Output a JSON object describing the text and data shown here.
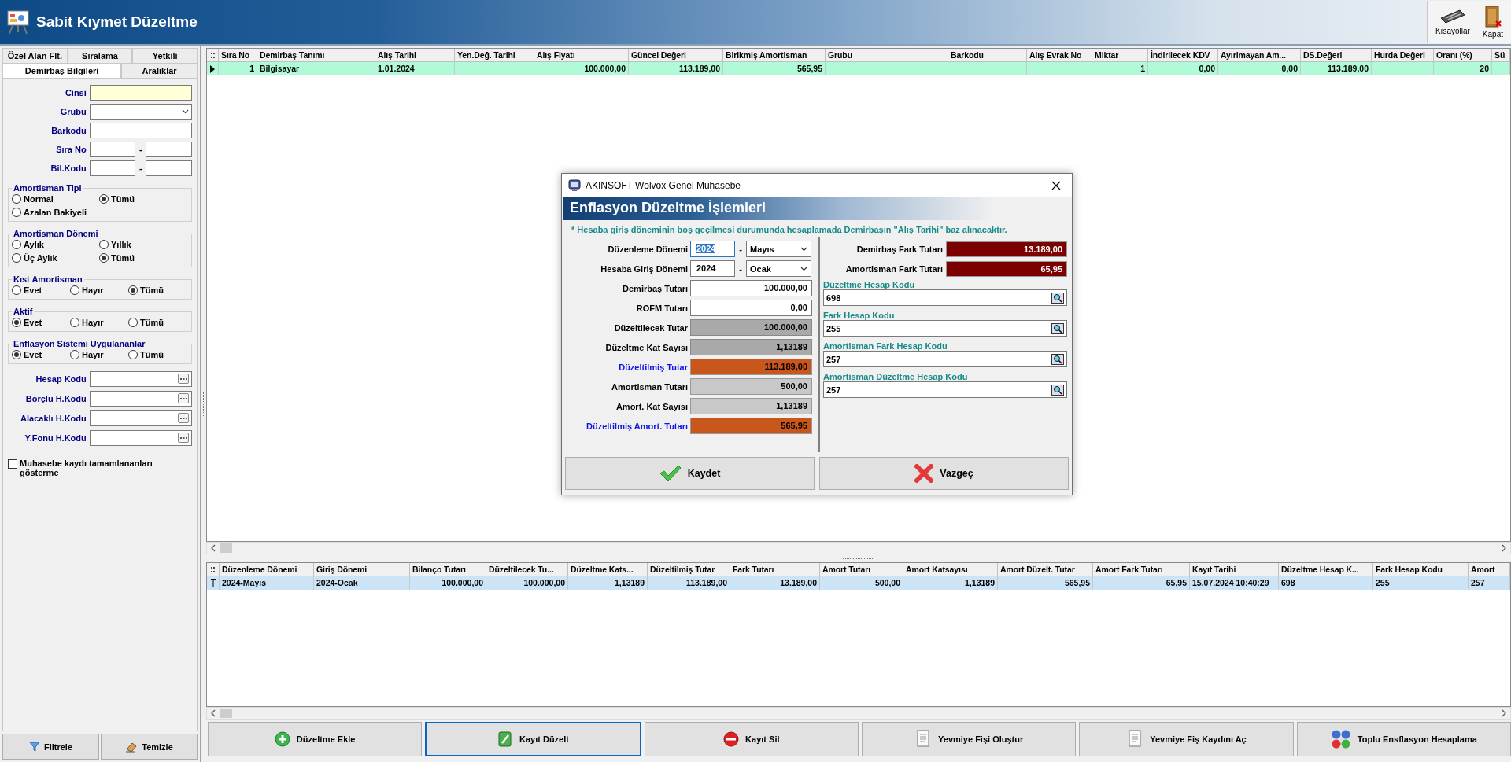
{
  "window": {
    "title": "Sabit Kıymet Düzeltme"
  },
  "toolbar": [
    {
      "label": "Kısayollar",
      "kind": "shortcuts"
    },
    {
      "label": "Kapat",
      "kind": "close"
    }
  ],
  "filter_panel": {
    "tab_rows": [
      {
        "tabs": [
          {
            "label": "Özel Alan Flt.",
            "selected": false
          },
          {
            "label": "Sıralama",
            "selected": false
          },
          {
            "label": "Yetkili",
            "selected": false
          }
        ]
      },
      {
        "tabs": [
          {
            "label": "Demirbaş Bilgileri",
            "selected": true
          },
          {
            "label": "Aralıklar",
            "selected": false
          }
        ]
      }
    ],
    "fields": [
      {
        "label": "Cinsi",
        "kind": "text",
        "highlighted": true
      },
      {
        "label": "Grubu",
        "kind": "dropdown",
        "highlighted": false
      },
      {
        "label": "Barkodu",
        "kind": "text",
        "highlighted": false
      },
      {
        "label": "Sıra No",
        "kind": "range",
        "separator": "-",
        "highlighted": false
      },
      {
        "label": "Bil.Kodu",
        "kind": "range",
        "separator": "-",
        "highlighted": false
      }
    ],
    "option_groups": [
      {
        "title": "Amortisman Tipi",
        "kind": "two_column",
        "options": [
          {
            "label": "Normal",
            "selected": false
          },
          {
            "label": "Tümü",
            "selected": true
          },
          {
            "label": "Azalan Bakiyeli",
            "selected": false
          }
        ]
      },
      {
        "title": "Amortisman Dönemi",
        "kind": "two_column",
        "options": [
          {
            "label": "Aylık",
            "selected": false
          },
          {
            "label": "Yıllık",
            "selected": false
          },
          {
            "label": "Üç Aylık",
            "selected": false
          },
          {
            "label": "Tümü",
            "selected": true
          }
        ]
      },
      {
        "title": "Kıst Amortisman",
        "kind": "three_column",
        "options": [
          {
            "label": "Evet",
            "selected": false
          },
          {
            "label": "Hayır",
            "selected": false
          },
          {
            "label": "Tümü",
            "selected": true
          }
        ]
      },
      {
        "title": "Aktif",
        "kind": "three_column",
        "options": [
          {
            "label": "Evet",
            "selected": true
          },
          {
            "label": "Hayır",
            "selected": false
          },
          {
            "label": "Tümü",
            "selected": false
          }
        ]
      },
      {
        "title": "Enflasyon Sistemi Uygulananlar",
        "kind": "three_column",
        "options": [
          {
            "label": "Evet",
            "selected": true
          },
          {
            "label": "Hayır",
            "selected": false
          },
          {
            "label": "Tümü",
            "selected": false
          }
        ]
      }
    ],
    "account_fields": [
      {
        "label": "Hesap Kodu"
      },
      {
        "label": "Borçlu H.Kodu"
      },
      {
        "label": "Alacaklı H.Kodu"
      },
      {
        "label": "Y.Fonu H.Kodu"
      }
    ],
    "checkbox": {
      "label": "Muhasebe kaydı tamamlananları gösterme",
      "checked": false
    },
    "buttons": [
      {
        "label": "Filtrele",
        "kind": "filter"
      },
      {
        "label": "Temizle",
        "kind": "clear"
      }
    ]
  },
  "assets_grid": {
    "columns": [
      "Sıra No",
      "Demirbaş Tanımı",
      "Alış Tarihi",
      "Yen.Değ. Tarihi",
      "Alış Fiyatı",
      "Güncel Değeri",
      "Birikmiş Amortisman",
      "Grubu",
      "Barkodu",
      "Alış Evrak No",
      "Miktar",
      "İndirilecek KDV",
      "Ayırlmayan Am...",
      "DS.Değeri",
      "Hurda Değeri",
      "Oranı (%)",
      "Sü"
    ],
    "rows": [
      {
        "selected": true,
        "cells": [
          "1",
          "Bilgisayar",
          "1.01.2024",
          null,
          "100.000,00",
          "113.189,00",
          "565,95",
          null,
          null,
          null,
          "1",
          "0,00",
          "0,00",
          "113.189,00",
          null,
          "20",
          null
        ]
      }
    ]
  },
  "adjustments_grid": {
    "columns": [
      "Düzenleme Dönemi",
      "Giriş Dönemi",
      "Bilanço Tutarı",
      "Düzeltilecek Tu...",
      "Düzeltme Kats...",
      "Düzeltilmiş Tutar",
      "Fark Tutarı",
      "Amort Tutarı",
      "Amort Katsayısı",
      "Amort Düzelt. Tutar",
      "Amort Fark Tutarı",
      "Kayıt Tarihi",
      "Düzeltme Hesap K...",
      "Fark Hesap Kodu",
      "Amort"
    ],
    "rows": [
      {
        "selected": true,
        "cells": [
          "2024-Mayıs",
          "2024-Ocak",
          "100.000,00",
          "100.000,00",
          "1,13189",
          "113.189,00",
          "13.189,00",
          "500,00",
          "1,13189",
          "565,95",
          "65,95",
          "15.07.2024 10:40:29",
          "698",
          "255",
          "257"
        ]
      }
    ]
  },
  "actions": [
    {
      "label": "Düzeltme Ekle",
      "kind": "add",
      "focused": false
    },
    {
      "label": "Kayıt Düzelt",
      "kind": "edit",
      "focused": true
    },
    {
      "label": "Kayıt Sil",
      "kind": "delete",
      "focused": false
    },
    {
      "label": "Yevmiye Fişi Oluştur",
      "kind": "document",
      "focused": false
    },
    {
      "label": "Yevmiye Fiş Kaydını Aç",
      "kind": "document",
      "focused": false
    },
    {
      "label": "Toplu Ensflasyon Hesaplama",
      "kind": "batch",
      "focused": false
    }
  ],
  "dialog": {
    "title": "AKINSOFT Wolvox Genel Muhasebe",
    "heading": "Enflasyon Düzeltme İşlemleri",
    "note": "* Hesaba giriş döneminin boş geçilmesi durumunda hesaplamada Demirbaşın \"Alış Tarihi\" baz alınacaktır.",
    "left_rows": [
      {
        "label": "Düzenleme Dönemi",
        "kind": "period",
        "year": "2024",
        "separator": "-",
        "month": "Mayıs",
        "focused": true
      },
      {
        "label": "Hesaba Giriş Dönemi",
        "kind": "period",
        "year": "2024",
        "separator": "-",
        "month": "Ocak",
        "focused": false
      },
      {
        "label": "Demirbaş Tutarı",
        "kind": "input",
        "value": "100.000,00"
      },
      {
        "label": "ROFM Tutarı",
        "kind": "input",
        "value": "0,00"
      },
      {
        "label": "Düzeltilecek Tutar",
        "kind": "computed",
        "value": "100.000,00"
      },
      {
        "label": "Düzeltme Kat Sayısı",
        "kind": "computed",
        "value": "1,13189"
      },
      {
        "label": "Düzeltilmiş Tutar",
        "kind": "result",
        "value": "113.189,00"
      },
      {
        "label": "Amortisman Tutarı",
        "kind": "computed_light",
        "value": "500,00"
      },
      {
        "label": "Amort. Kat Sayısı",
        "kind": "computed_light",
        "value": "1,13189"
      },
      {
        "label": "Düzeltilmiş Amort. Tutarı",
        "kind": "result",
        "value": "565,95"
      }
    ],
    "totals": [
      {
        "label": "Demirbaş Fark Tutarı",
        "value": "13.189,00"
      },
      {
        "label": "Amortisman Fark Tutarı",
        "value": "65,95"
      }
    ],
    "accounts": [
      {
        "label": "Düzeltme Hesap Kodu",
        "value": "698"
      },
      {
        "label": "Fark Hesap Kodu",
        "value": "255"
      },
      {
        "label": "Amortisman Fark Hesap Kodu",
        "value": "257"
      },
      {
        "label": "Amortisman Düzeltme Hesap Kodu",
        "value": "257"
      }
    ],
    "buttons": [
      {
        "label": "Kaydet",
        "kind": "ok"
      },
      {
        "label": "Vazgeç",
        "kind": "cancel"
      }
    ]
  }
}
